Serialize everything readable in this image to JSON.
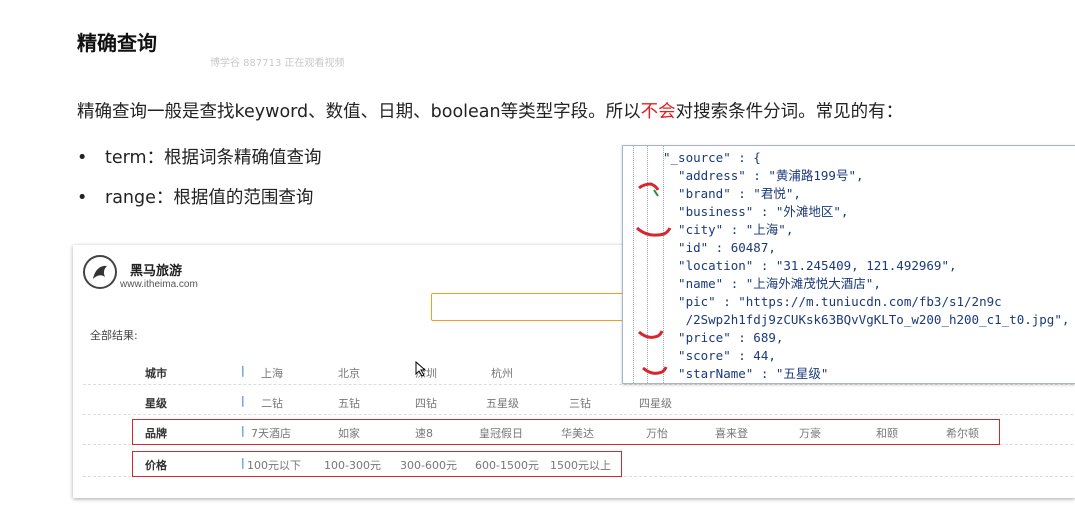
{
  "heading": "精确查询",
  "watermark": "博学谷 887713 正在观看视频",
  "intro": {
    "before": "精确查询一般是查找keyword、数值、日期、boolean等类型字段。所以",
    "highlight": "不会",
    "after": "对搜索条件分词。常见的有："
  },
  "bullets": [
    {
      "dot": "•",
      "text": "term：根据词条精确值查询"
    },
    {
      "dot": "•",
      "text": "range：根据值的范围查询"
    }
  ],
  "site": {
    "logo_name": "黑马旅游",
    "logo_url": "www.itheima.com",
    "all_results": "全部结果:",
    "filters": [
      {
        "label": "城市",
        "values": [
          "上海",
          "北京",
          "深圳",
          "杭州"
        ]
      },
      {
        "label": "星级",
        "values": [
          "二钻",
          "五钻",
          "四钻",
          "五星级",
          "三钻",
          "四星级"
        ]
      },
      {
        "label": "品牌",
        "values": [
          "7天酒店",
          "如家",
          "速8",
          "皇冠假日",
          "华美达",
          "万怡",
          "喜来登",
          "万豪",
          "和颐",
          "希尔顿"
        ]
      },
      {
        "label": "价格",
        "values": [
          "100元以下",
          "100-300元",
          "300-600元",
          "600-1500元",
          "1500元以上"
        ]
      }
    ],
    "separator": "|"
  },
  "json_panel": {
    "lines": [
      "\"_source\" : {",
      "  \"address\" : \"黄浦路199号\",",
      "  \"brand\" : \"君悦\",",
      "  \"business\" : \"外滩地区\",",
      "  \"city\" : \"上海\",",
      "  \"id\" : 60487,",
      "  \"location\" : \"31.245409, 121.492969\",",
      "  \"name\" : \"上海外滩茂悦大酒店\",",
      "  \"pic\" : \"https://m.tuniucdn.com/fb3/s1/2n9c",
      "   /2Swp2h1fdj9zCUKsk63BQvVgKLTo_w200_h200_c1_t0.jpg\",",
      "  \"price\" : 689,",
      "  \"score\" : 44,",
      "  \"starName\" : \"五星级\""
    ]
  },
  "colors": {
    "highlight": "#e02020",
    "box": "#d8262c",
    "json_text": "#1b3a7a"
  }
}
